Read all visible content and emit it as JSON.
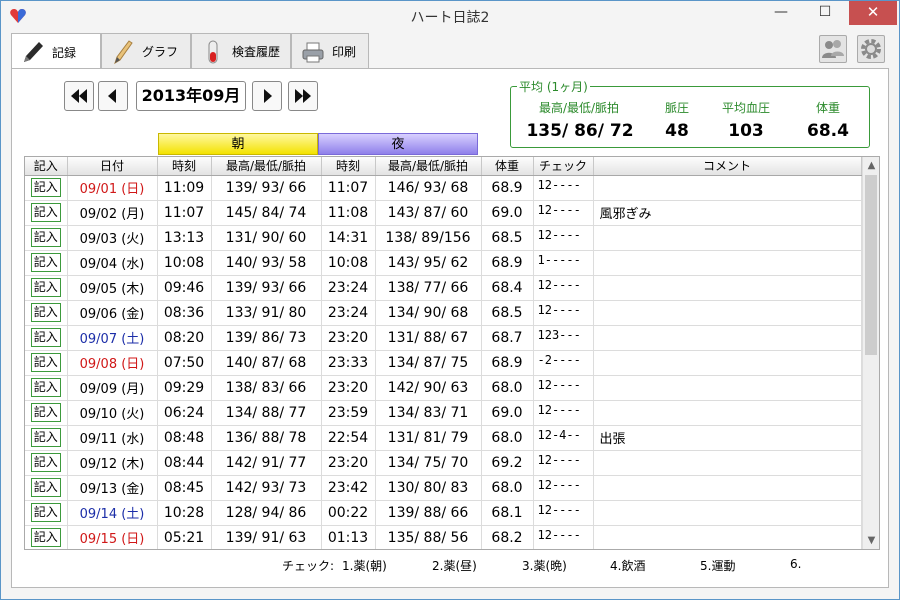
{
  "window": {
    "title": "ハート日誌2",
    "minimize": "—",
    "maximize": "☐",
    "close": "✕"
  },
  "tabs": [
    {
      "label": "記録",
      "icon": "pencil-icon"
    },
    {
      "label": "グラフ",
      "icon": "pen-icon"
    },
    {
      "label": "検査履歴",
      "icon": "test-tube-icon"
    },
    {
      "label": "印刷",
      "icon": "printer-icon"
    }
  ],
  "toolbar": {
    "users_icon": "users-icon",
    "settings_icon": "gear-icon"
  },
  "nav": {
    "month": "2013年09月",
    "first_icon": "double-left-icon",
    "prev_icon": "left-icon",
    "next_icon": "right-icon",
    "last_icon": "double-right-icon"
  },
  "average": {
    "title": "平均 (1ヶ月)",
    "bp_label": "最高/最低/脈拍",
    "bp_value": "135/ 86/ 72",
    "pulse_pressure_label": "脈圧",
    "pulse_pressure_value": "48",
    "mean_bp_label": "平均血圧",
    "mean_bp_value": "103",
    "weight_label": "体重",
    "weight_value": "68.4"
  },
  "bands": {
    "morning": "朝",
    "night": "夜"
  },
  "columns": [
    "記入",
    "日付",
    "時刻",
    "最高/最低/脈拍",
    "時刻",
    "最高/最低/脈拍",
    "体重",
    "チェック",
    "コメント"
  ],
  "rows": [
    {
      "entry": "記入",
      "date": "09/01 (日)",
      "day": "sun",
      "am_time": "11:09",
      "am_bp": "139/ 93/ 66",
      "pm_time": "11:07",
      "pm_bp": "146/ 93/ 68",
      "weight": "68.9",
      "check": "12----",
      "comment": ""
    },
    {
      "entry": "記入",
      "date": "09/02 (月)",
      "day": "week",
      "am_time": "11:07",
      "am_bp": "145/ 84/ 74",
      "pm_time": "11:08",
      "pm_bp": "143/ 87/ 60",
      "weight": "69.0",
      "check": "12----",
      "comment": "風邪ぎみ"
    },
    {
      "entry": "記入",
      "date": "09/03 (火)",
      "day": "week",
      "am_time": "13:13",
      "am_bp": "131/ 90/ 60",
      "pm_time": "14:31",
      "pm_bp": "138/ 89/156",
      "weight": "68.5",
      "check": "12----",
      "comment": ""
    },
    {
      "entry": "記入",
      "date": "09/04 (水)",
      "day": "week",
      "am_time": "10:08",
      "am_bp": "140/ 93/ 58",
      "pm_time": "10:08",
      "pm_bp": "143/ 95/ 62",
      "weight": "68.9",
      "check": "1-----",
      "comment": ""
    },
    {
      "entry": "記入",
      "date": "09/05 (木)",
      "day": "week",
      "am_time": "09:46",
      "am_bp": "139/ 93/ 66",
      "pm_time": "23:24",
      "pm_bp": "138/ 77/ 66",
      "weight": "68.4",
      "check": "12----",
      "comment": ""
    },
    {
      "entry": "記入",
      "date": "09/06 (金)",
      "day": "week",
      "am_time": "08:36",
      "am_bp": "133/ 91/ 80",
      "pm_time": "23:24",
      "pm_bp": "134/ 90/ 68",
      "weight": "68.5",
      "check": "12----",
      "comment": ""
    },
    {
      "entry": "記入",
      "date": "09/07 (土)",
      "day": "sat",
      "am_time": "08:20",
      "am_bp": "139/ 86/ 73",
      "pm_time": "23:20",
      "pm_bp": "131/ 88/ 67",
      "weight": "68.7",
      "check": "123---",
      "comment": ""
    },
    {
      "entry": "記入",
      "date": "09/08 (日)",
      "day": "sun",
      "am_time": "07:50",
      "am_bp": "140/ 87/ 68",
      "pm_time": "23:33",
      "pm_bp": "134/ 87/ 75",
      "weight": "68.9",
      "check": "-2----",
      "comment": ""
    },
    {
      "entry": "記入",
      "date": "09/09 (月)",
      "day": "week",
      "am_time": "09:29",
      "am_bp": "138/ 83/ 66",
      "pm_time": "23:20",
      "pm_bp": "142/ 90/ 63",
      "weight": "68.0",
      "check": "12----",
      "comment": ""
    },
    {
      "entry": "記入",
      "date": "09/10 (火)",
      "day": "week",
      "am_time": "06:24",
      "am_bp": "134/ 88/ 77",
      "pm_time": "23:59",
      "pm_bp": "134/ 83/ 71",
      "weight": "69.0",
      "check": "12----",
      "comment": ""
    },
    {
      "entry": "記入",
      "date": "09/11 (水)",
      "day": "week",
      "am_time": "08:48",
      "am_bp": "136/ 88/ 78",
      "pm_time": "22:54",
      "pm_bp": "131/ 81/ 79",
      "weight": "68.0",
      "check": "12-4--",
      "comment": "出張"
    },
    {
      "entry": "記入",
      "date": "09/12 (木)",
      "day": "week",
      "am_time": "08:44",
      "am_bp": "142/ 91/ 77",
      "pm_time": "23:20",
      "pm_bp": "134/ 75/ 70",
      "weight": "69.2",
      "check": "12----",
      "comment": ""
    },
    {
      "entry": "記入",
      "date": "09/13 (金)",
      "day": "week",
      "am_time": "08:45",
      "am_bp": "142/ 93/ 73",
      "pm_time": "23:42",
      "pm_bp": "130/ 80/ 83",
      "weight": "68.0",
      "check": "12----",
      "comment": ""
    },
    {
      "entry": "記入",
      "date": "09/14 (土)",
      "day": "sat",
      "am_time": "10:28",
      "am_bp": "128/ 94/ 86",
      "pm_time": "00:22",
      "pm_bp": "139/ 88/ 66",
      "weight": "68.1",
      "check": "12----",
      "comment": ""
    },
    {
      "entry": "記入",
      "date": "09/15 (日)",
      "day": "sun",
      "am_time": "05:21",
      "am_bp": "139/ 91/ 63",
      "pm_time": "01:13",
      "pm_bp": "135/ 88/ 56",
      "weight": "68.2",
      "check": "12----",
      "comment": ""
    }
  ],
  "legend": {
    "label": "チェック:",
    "items": [
      "1.薬(朝)",
      "2.薬(昼)",
      "3.薬(晩)",
      "4.飲酒",
      "5.運動",
      "6."
    ]
  },
  "colors": {
    "sunday": "#d01818",
    "saturday": "#1c2ea8",
    "accent_green": "#2b8a2b"
  }
}
